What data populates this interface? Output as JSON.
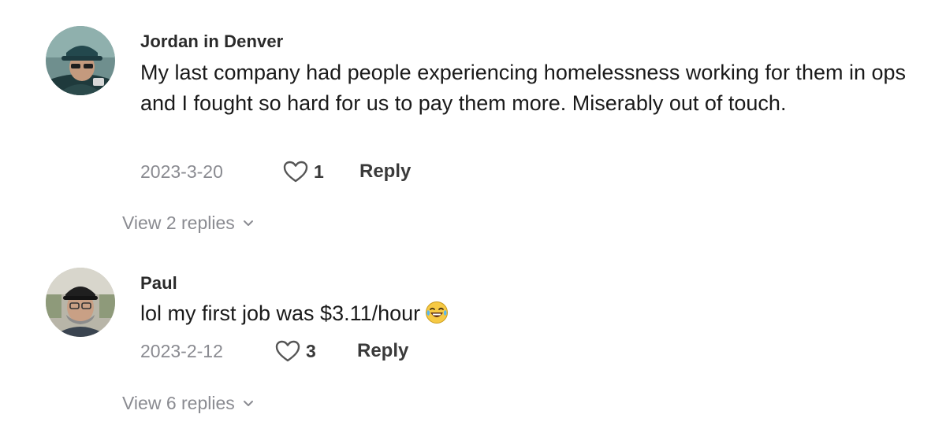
{
  "comments": [
    {
      "username": "Jordan in Denver",
      "text": "My last company had people experiencing homelessness working for them in ops and I fought so hard for us to pay them more. Miserably out of touch.",
      "date": "2023-3-20",
      "likes": "1",
      "reply_label": "Reply",
      "view_replies": "View 2 replies",
      "avatar_icon": "user-avatar-cap-sunglasses"
    },
    {
      "username": "Paul",
      "text": "lol my first job was $3.11/hour",
      "emoji": "laughing-tears-emoji",
      "date": "2023-2-12",
      "likes": "3",
      "reply_label": "Reply",
      "view_replies": "View 6 replies",
      "avatar_icon": "user-avatar-cap-glasses"
    }
  ],
  "colors": {
    "username": "#2a2a2a",
    "body_text": "#1a1a1a",
    "muted": "#8a8b91",
    "action": "#3a3a3a"
  }
}
